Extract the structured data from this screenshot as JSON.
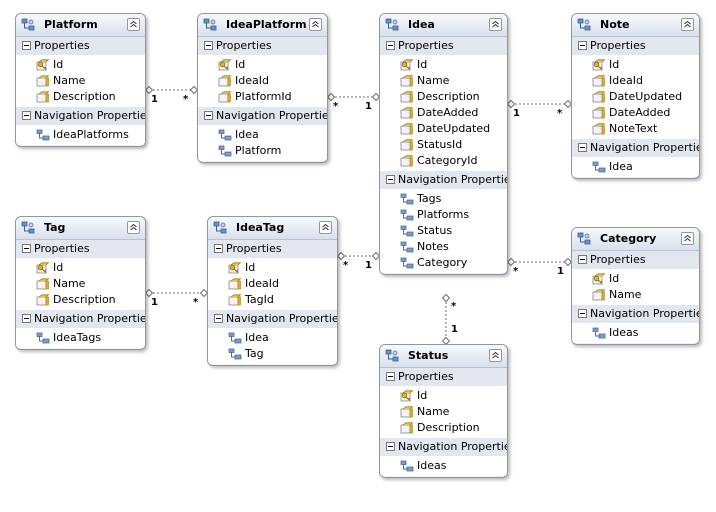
{
  "sections": {
    "properties": "Properties",
    "navigation": "Navigation Properties"
  },
  "entities": {
    "platform": {
      "name": "Platform",
      "properties": [
        {
          "name": "Id",
          "key": true
        },
        {
          "name": "Name"
        },
        {
          "name": "Description"
        }
      ],
      "navigation": [
        "IdeaPlatforms"
      ]
    },
    "ideaPlatform": {
      "name": "IdeaPlatform",
      "properties": [
        {
          "name": "Id",
          "key": true
        },
        {
          "name": "IdeaId"
        },
        {
          "name": "PlatformId"
        }
      ],
      "navigation": [
        "Idea",
        "Platform"
      ]
    },
    "idea": {
      "name": "Idea",
      "properties": [
        {
          "name": "Id",
          "key": true
        },
        {
          "name": "Name"
        },
        {
          "name": "Description"
        },
        {
          "name": "DateAdded"
        },
        {
          "name": "DateUpdated"
        },
        {
          "name": "StatusId"
        },
        {
          "name": "CategoryId"
        }
      ],
      "navigation": [
        "Tags",
        "Platforms",
        "Status",
        "Notes",
        "Category"
      ]
    },
    "note": {
      "name": "Note",
      "properties": [
        {
          "name": "Id",
          "key": true
        },
        {
          "name": "IdeaId"
        },
        {
          "name": "DateUpdated"
        },
        {
          "name": "DateAdded"
        },
        {
          "name": "NoteText"
        }
      ],
      "navigation": [
        "Idea"
      ]
    },
    "tag": {
      "name": "Tag",
      "properties": [
        {
          "name": "Id",
          "key": true
        },
        {
          "name": "Name"
        },
        {
          "name": "Description"
        }
      ],
      "navigation": [
        "IdeaTags"
      ]
    },
    "ideaTag": {
      "name": "IdeaTag",
      "properties": [
        {
          "name": "Id",
          "key": true
        },
        {
          "name": "IdeaId"
        },
        {
          "name": "TagId"
        }
      ],
      "navigation": [
        "Idea",
        "Tag"
      ]
    },
    "category": {
      "name": "Category",
      "properties": [
        {
          "name": "Id",
          "key": true
        },
        {
          "name": "Name"
        }
      ],
      "navigation": [
        "Ideas"
      ]
    },
    "status": {
      "name": "Status",
      "properties": [
        {
          "name": "Id",
          "key": true
        },
        {
          "name": "Name"
        },
        {
          "name": "Description"
        }
      ],
      "navigation": [
        "Ideas"
      ]
    }
  },
  "associations": [
    {
      "from": "platform",
      "to": "ideaPlatform",
      "from_multiplicity": "1",
      "to_multiplicity": "*"
    },
    {
      "from": "ideaPlatform",
      "to": "idea",
      "from_multiplicity": "*",
      "to_multiplicity": "1"
    },
    {
      "from": "idea",
      "to": "note",
      "from_multiplicity": "1",
      "to_multiplicity": "*"
    },
    {
      "from": "tag",
      "to": "ideaTag",
      "from_multiplicity": "1",
      "to_multiplicity": "*"
    },
    {
      "from": "ideaTag",
      "to": "idea",
      "from_multiplicity": "*",
      "to_multiplicity": "1"
    },
    {
      "from": "idea",
      "to": "category",
      "from_multiplicity": "*",
      "to_multiplicity": "1"
    },
    {
      "from": "idea",
      "to": "status",
      "from_multiplicity": "*",
      "to_multiplicity": "1"
    }
  ],
  "colors": {
    "border": "#8e97a3",
    "section_header": "#e2e7ef",
    "connector": "#6f6f6f",
    "key_icon": "#e0b630"
  }
}
